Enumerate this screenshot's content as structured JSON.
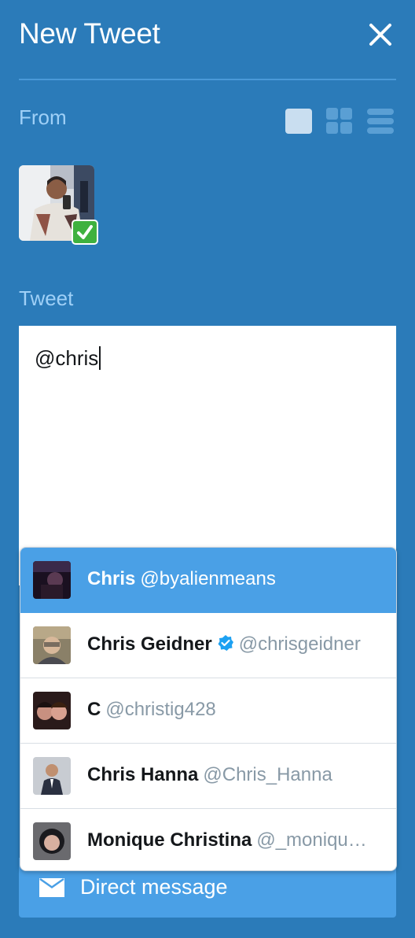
{
  "header": {
    "title": "New Tweet",
    "close_icon": "close-icon"
  },
  "from": {
    "label": "From",
    "layout_icons": [
      "single-column-icon",
      "grid-icon",
      "list-icon"
    ],
    "account_selected": true
  },
  "tweet": {
    "label": "Tweet",
    "value": "@chris"
  },
  "suggestions": [
    {
      "name": "Chris",
      "handle": "@byalienmeans",
      "verified": false,
      "active": true
    },
    {
      "name": "Chris Geidner",
      "handle": "@chrisgeidner",
      "verified": true,
      "active": false
    },
    {
      "name": "C",
      "handle": "@christig428",
      "verified": false,
      "active": false
    },
    {
      "name": "Chris Hanna",
      "handle": "@Chris_Hanna",
      "verified": false,
      "active": false
    },
    {
      "name": "Monique Christina",
      "handle": "@_moniqu…",
      "verified": false,
      "active": false
    }
  ],
  "direct_message": {
    "label": "Direct message",
    "icon": "envelope-icon"
  },
  "colors": {
    "background": "#2b7bb9",
    "accent": "#4aa0e6",
    "check": "#3fb13f",
    "label": "#9fd0f7"
  }
}
